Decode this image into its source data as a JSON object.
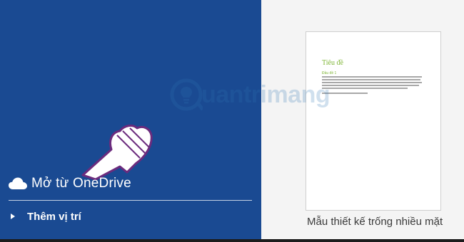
{
  "sidebar": {
    "background_color": "#1a4a92",
    "onedrive_item": {
      "label": "Mở từ OneDrive",
      "icon": "cloud-icon"
    },
    "add_place_item": {
      "label": "Thêm vị trí",
      "icon": "triangle-right-icon"
    }
  },
  "template_preview": {
    "doc_title": "Tiêu đề",
    "doc_heading": "Đầu đề 1",
    "caption": "Mẫu thiết kế trống nhiều mặt",
    "accent_color": "#7fb636"
  },
  "watermark": {
    "text": "uantrimang",
    "icon": "lightbulb-icon"
  },
  "cursor": {
    "icon": "hand-pointer-icon"
  }
}
